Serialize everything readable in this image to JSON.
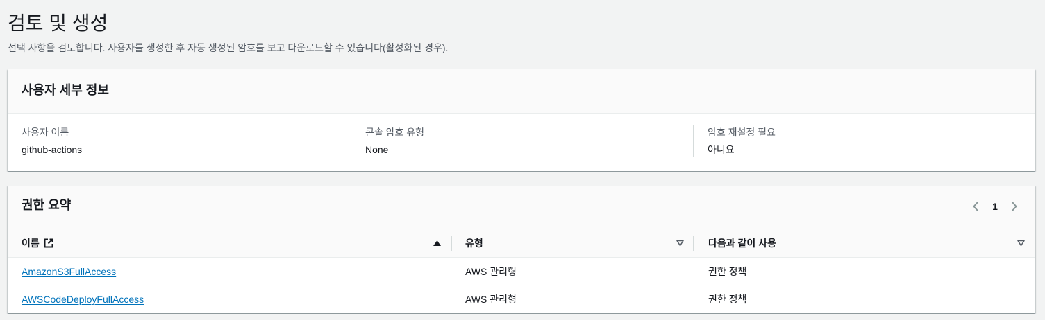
{
  "page": {
    "title": "검토 및 생성",
    "description": "선택 사항을 검토합니다. 사용자를 생성한 후 자동 생성된 암호를 보고 다운로드할 수 있습니다(활성화된 경우)."
  },
  "user_details": {
    "heading": "사용자 세부 정보",
    "fields": [
      {
        "label": "사용자 이름",
        "value": "github-actions"
      },
      {
        "label": "콘솔 암호 유형",
        "value": "None"
      },
      {
        "label": "암호 재설정 필요",
        "value": "아니요"
      }
    ]
  },
  "permissions": {
    "heading": "권한 요약",
    "pagination": {
      "current_page": "1",
      "previous_icon": "chevron-left-icon",
      "next_icon": "chevron-right-icon"
    },
    "columns": [
      {
        "label": "이름",
        "icon": "external-link-icon",
        "sort_icon": "sort-ascending-icon"
      },
      {
        "label": "유형",
        "sort_icon": "sort-icon"
      },
      {
        "label": "다음과 같이 사용",
        "sort_icon": "sort-icon"
      }
    ],
    "rows": [
      {
        "name": "AmazonS3FullAccess",
        "type": "AWS 관리형",
        "used_as": "권한 정책"
      },
      {
        "name": "AWSCodeDeployFullAccess",
        "type": "AWS 관리형",
        "used_as": "권한 정책"
      }
    ]
  },
  "colors": {
    "page_background": "#f2f3f3",
    "card_background": "#ffffff",
    "header_background": "#fafafa",
    "text": "#16191f",
    "secondary_text": "#545b64",
    "link": "#0073bb",
    "divider": "#eaeded",
    "column_divider": "#d5dbdb",
    "icon_muted": "#879596"
  }
}
